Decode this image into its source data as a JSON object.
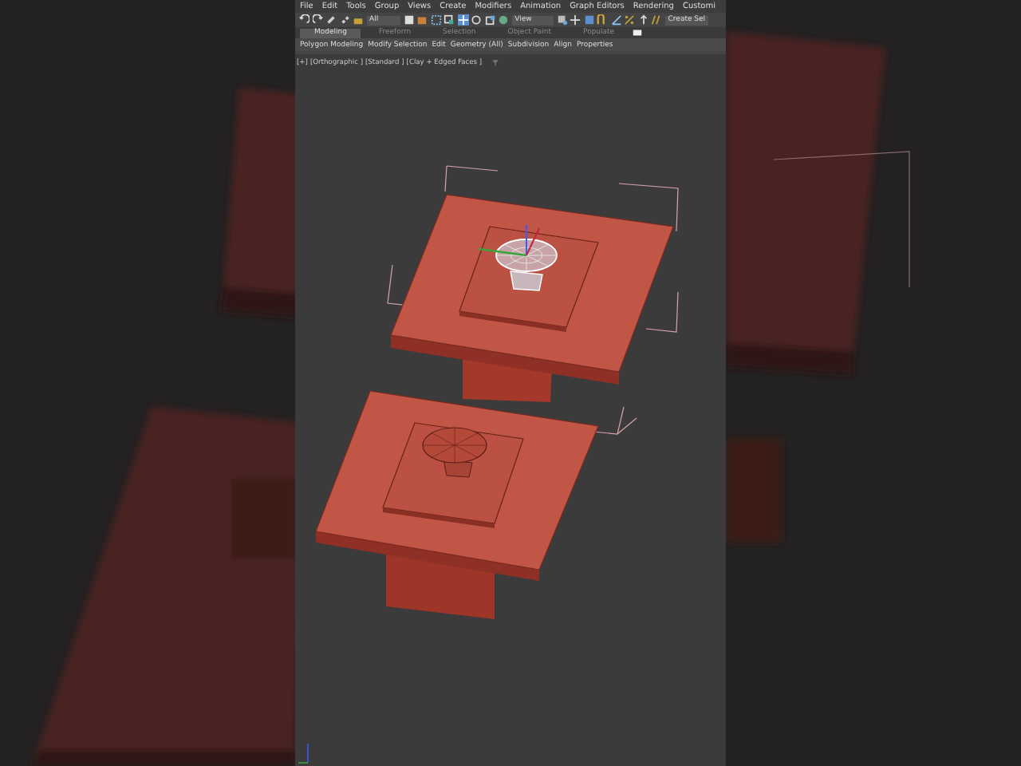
{
  "menu_bar": [
    "File",
    "Edit",
    "Tools",
    "Group",
    "Views",
    "Create",
    "Modifiers",
    "Animation",
    "Graph Editors",
    "Rendering",
    "Customi"
  ],
  "toolbar": {
    "selection_filter": "All",
    "coordinate_system": "View",
    "selection_set": "Create Sel"
  },
  "ribbon_tabs": [
    {
      "label": "Modeling",
      "selected": true
    },
    {
      "label": "Freeform",
      "selected": false
    },
    {
      "label": "Selection",
      "selected": false
    },
    {
      "label": "Object Paint",
      "selected": false
    },
    {
      "label": "Populate",
      "selected": false
    }
  ],
  "ribbon_panels": [
    "Polygon Modeling",
    "Modify Selection",
    "Edit",
    "Geometry (All)",
    "Subdivision",
    "Align",
    "Properties"
  ],
  "viewport": {
    "labels": [
      "[+]",
      "[Orthographic ]",
      "[Standard ]",
      "[Clay + Edged Faces ]"
    ]
  }
}
